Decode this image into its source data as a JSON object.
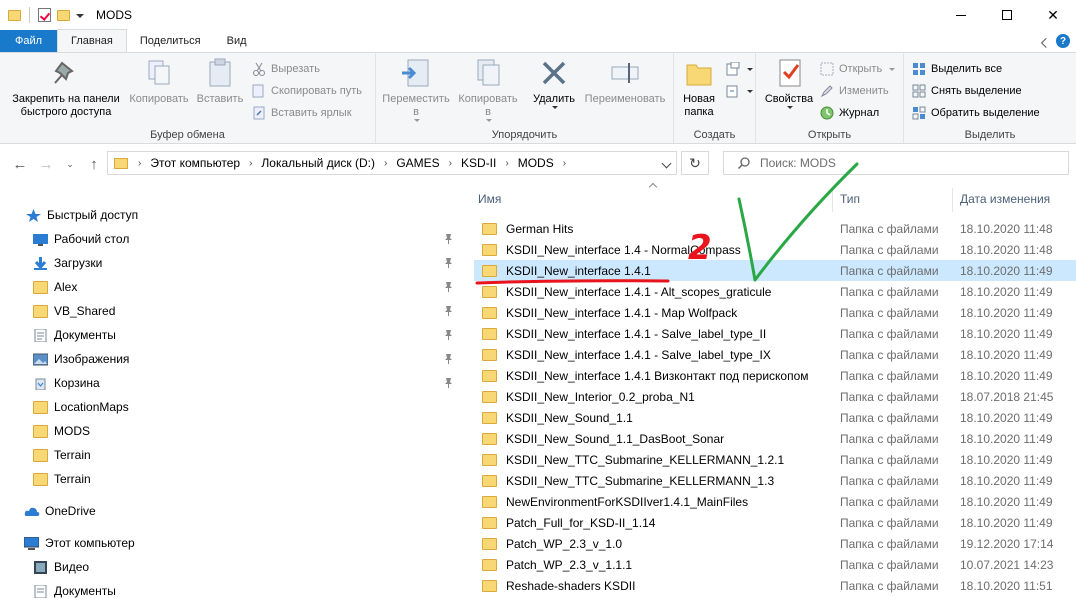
{
  "window": {
    "title": "MODS"
  },
  "tabs": [
    {
      "label": "Файл"
    },
    {
      "label": "Главная"
    },
    {
      "label": "Поделиться"
    },
    {
      "label": "Вид"
    }
  ],
  "ribbon": {
    "clipboard": {
      "label": "Буфер обмена",
      "pin": "Закрепить на панели быстрого доступа",
      "copy": "Копировать",
      "paste": "Вставить",
      "cut": "Вырезать",
      "copy_path": "Скопировать путь",
      "paste_shortcut": "Вставить ярлык"
    },
    "organize": {
      "label": "Упорядочить",
      "move": "Переместить в",
      "copy_to": "Копировать в",
      "delete": "Удалить",
      "rename": "Переименовать"
    },
    "create": {
      "label": "Создать",
      "new_folder": "Новая папка"
    },
    "open": {
      "label": "Открыть",
      "properties": "Свойства",
      "open": "Открыть",
      "edit": "Изменить",
      "history": "Журнал"
    },
    "select": {
      "label": "Выделить",
      "select_all": "Выделить все",
      "select_none": "Снять выделение",
      "invert": "Обратить выделение"
    }
  },
  "address": {
    "crumbs": [
      "Этот компьютер",
      "Локальный диск (D:)",
      "GAMES",
      "KSD-II",
      "MODS"
    ],
    "search_placeholder": "Поиск: MODS"
  },
  "nav": {
    "quick_access": "Быстрый доступ",
    "items": [
      {
        "label": "Рабочий стол",
        "icon": "desktop-icon",
        "pinned": true
      },
      {
        "label": "Загрузки",
        "icon": "downloads-icon",
        "pinned": true
      },
      {
        "label": "Alex",
        "icon": "folder-icon",
        "pinned": true
      },
      {
        "label": "VB_Shared",
        "icon": "folder-icon",
        "pinned": true
      },
      {
        "label": "Документы",
        "icon": "documents-icon",
        "pinned": true
      },
      {
        "label": "Изображения",
        "icon": "pictures-icon",
        "pinned": true
      },
      {
        "label": "Корзина",
        "icon": "recycle-bin-icon",
        "pinned": true
      },
      {
        "label": "LocationMaps",
        "icon": "folder-icon",
        "pinned": false
      },
      {
        "label": "MODS",
        "icon": "folder-icon",
        "pinned": false
      },
      {
        "label": "Terrain",
        "icon": "folder-icon",
        "pinned": false
      },
      {
        "label": "Terrain",
        "icon": "folder-icon",
        "pinned": false
      }
    ],
    "onedrive": "OneDrive",
    "this_pc": "Этот компьютер",
    "pc_items": [
      {
        "label": "Видео",
        "icon": "video-icon"
      },
      {
        "label": "Документы",
        "icon": "documents-icon"
      }
    ]
  },
  "columns": {
    "name": "Имя",
    "type": "Тип",
    "date": "Дата изменения"
  },
  "files": [
    {
      "name": "German Hits",
      "type": "Папка с файлами",
      "date": "18.10.2020 11:48"
    },
    {
      "name": "KSDII_New_interface 1.4 - NormalCompass",
      "type": "Папка с файлами",
      "date": "18.10.2020 11:48"
    },
    {
      "name": "KSDII_New_interface 1.4.1",
      "type": "Папка с файлами",
      "date": "18.10.2020 11:49",
      "selected": true
    },
    {
      "name": "KSDII_New_interface 1.4.1 - Alt_scopes_graticule",
      "type": "Папка с файлами",
      "date": "18.10.2020 11:49"
    },
    {
      "name": "KSDII_New_interface 1.4.1 - Map Wolfpack",
      "type": "Папка с файлами",
      "date": "18.10.2020 11:49"
    },
    {
      "name": "KSDII_New_interface 1.4.1 - Salve_label_type_II",
      "type": "Папка с файлами",
      "date": "18.10.2020 11:49"
    },
    {
      "name": "KSDII_New_interface 1.4.1 - Salve_label_type_IX",
      "type": "Папка с файлами",
      "date": "18.10.2020 11:49"
    },
    {
      "name": "KSDII_New_interface 1.4.1 Визконтакт под перископом",
      "type": "Папка с файлами",
      "date": "18.10.2020 11:49"
    },
    {
      "name": "KSDII_New_Interior_0.2_proba_N1",
      "type": "Папка с файлами",
      "date": "18.07.2018 21:45"
    },
    {
      "name": "KSDII_New_Sound_1.1",
      "type": "Папка с файлами",
      "date": "18.10.2020 11:49"
    },
    {
      "name": "KSDII_New_Sound_1.1_DasBoot_Sonar",
      "type": "Папка с файлами",
      "date": "18.10.2020 11:49"
    },
    {
      "name": "KSDII_New_TTC_Submarine_KELLERMANN_1.2.1",
      "type": "Папка с файлами",
      "date": "18.10.2020 11:49"
    },
    {
      "name": "KSDII_New_TTC_Submarine_KELLERMANN_1.3",
      "type": "Папка с файлами",
      "date": "18.10.2020 11:49"
    },
    {
      "name": "NewEnvironmentForKSDIIver1.4.1_MainFiles",
      "type": "Папка с файлами",
      "date": "18.10.2020 11:49"
    },
    {
      "name": "Patch_Full_for_KSD-II_1.14",
      "type": "Папка с файлами",
      "date": "18.10.2020 11:49"
    },
    {
      "name": "Patch_WP_2.3_v_1.0",
      "type": "Папка с файлами",
      "date": "19.12.2020 17:14"
    },
    {
      "name": "Patch_WP_2.3_v_1.1.1",
      "type": "Папка с файлами",
      "date": "10.07.2021 14:23"
    },
    {
      "name": "Reshade-shaders KSDII",
      "type": "Папка с файлами",
      "date": "18.10.2020 11:51"
    }
  ],
  "annotation": {
    "number": "2"
  }
}
